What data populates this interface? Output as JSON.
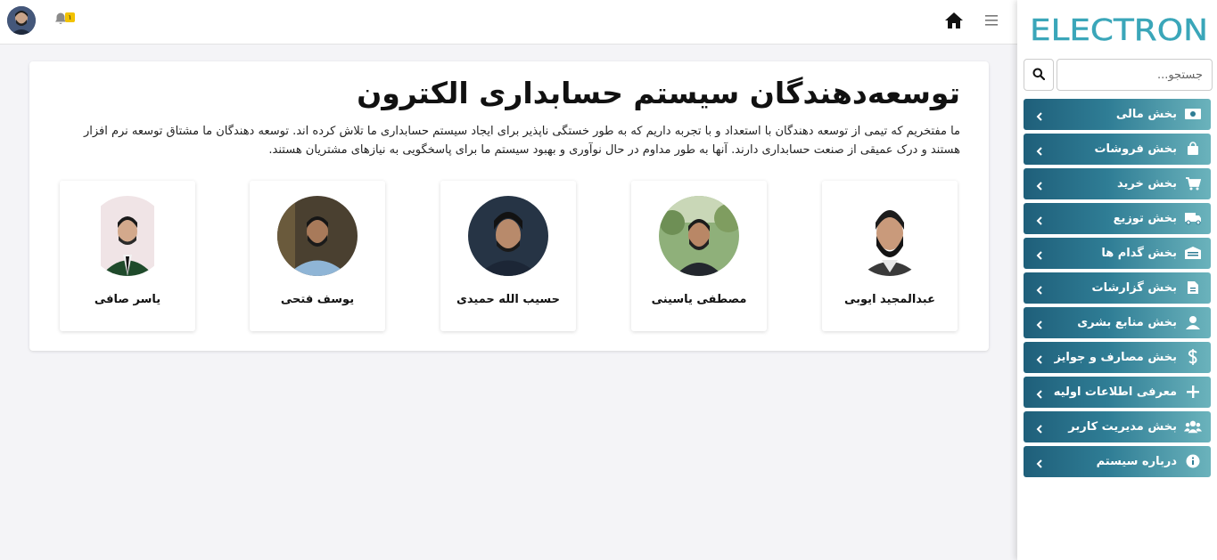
{
  "header": {
    "notification_count": "۱"
  },
  "sidebar": {
    "logo_text": "ELECTRON",
    "search": {
      "placeholder": "جستجو..."
    },
    "items": [
      {
        "label": "بخش مالی",
        "icon": "money-icon"
      },
      {
        "label": "بخش فروشات",
        "icon": "shopping-bag-icon"
      },
      {
        "label": "بخش خرید",
        "icon": "cart-icon"
      },
      {
        "label": "بخش توزیع",
        "icon": "truck-icon"
      },
      {
        "label": "بخش گدام ها",
        "icon": "warehouse-icon"
      },
      {
        "label": "بخش گزارشات",
        "icon": "file-icon"
      },
      {
        "label": "بخش منابع بشری",
        "icon": "user-icon"
      },
      {
        "label": "بخش مصارف و جوایز",
        "icon": "dollar-icon"
      },
      {
        "label": "معرفی اطلاعات اولیه",
        "icon": "plus-icon"
      },
      {
        "label": "بخش مدیریت کاربر",
        "icon": "users-icon"
      },
      {
        "label": "درباره سیستم",
        "icon": "info-icon"
      }
    ]
  },
  "main": {
    "title": "توسعه‌دهندگان سیستم حسابداری الکترون",
    "description": "ما مفتخریم که تیمی از توسعه دهندگان با استعداد و با تجربه داریم که به طور خستگی ناپذیر برای ایجاد سیستم حسابداری ما تلاش کرده اند. توسعه دهندگان ما مشتاق توسعه نرم افزار هستند و درک عمیقی از صنعت حسابداری دارند. آنها به طور مداوم در حال نوآوری و بهبود سیستم ما برای پاسخگویی به نیازهای مشتریان هستند.",
    "developers": [
      {
        "name": "عبدالمجید ایوبی"
      },
      {
        "name": "مصطفی یاسینی"
      },
      {
        "name": "حسیب الله حمیدی"
      },
      {
        "name": "یوسف فتحی"
      },
      {
        "name": "یاسر صافی"
      }
    ]
  },
  "colors": {
    "menu_dark": "#1f5f7a",
    "menu_light": "#6bb3bc",
    "logo": "#3aa6b9"
  }
}
